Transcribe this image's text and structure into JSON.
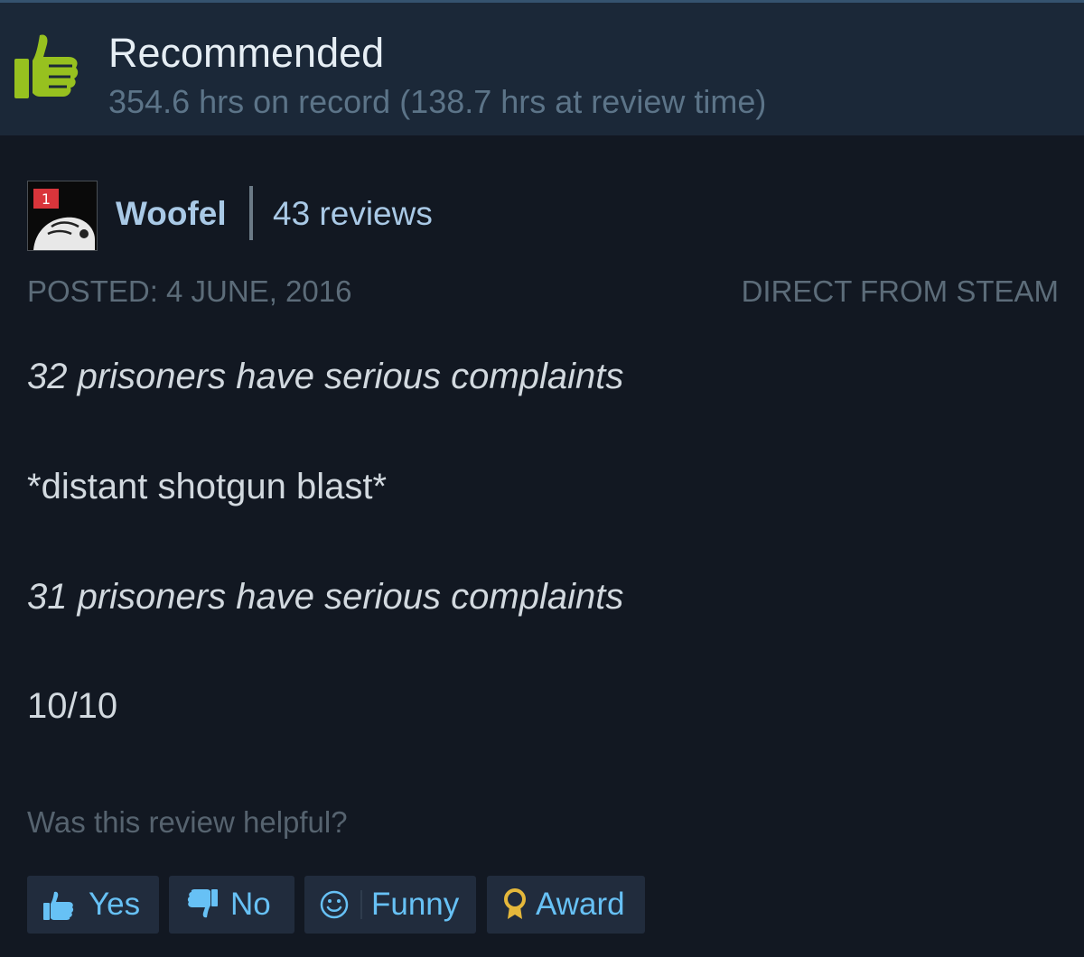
{
  "header": {
    "verdict": "Recommended",
    "hours": "354.6 hrs on record (138.7 hrs at review time)",
    "verdict_icon": "thumbs-up-icon",
    "accent": "#97c11f"
  },
  "author": {
    "badge": "1",
    "name": "Woofel",
    "reviews": "43 reviews"
  },
  "meta": {
    "posted": "POSTED: 4 JUNE, 2016",
    "source": "DIRECT FROM STEAM"
  },
  "review": {
    "lines": [
      "32 prisoners have serious complaints",
      "*distant shotgun blast*",
      "31 prisoners have serious complaints",
      "10/10"
    ]
  },
  "helpful": {
    "question": "Was this review helpful?",
    "buttons": [
      {
        "label": "Yes",
        "icon": "thumbs-up-icon"
      },
      {
        "label": "No",
        "icon": "thumbs-down-icon"
      },
      {
        "label": "Funny",
        "icon": "smiley-icon"
      },
      {
        "label": "Award",
        "icon": "award-icon"
      }
    ]
  },
  "colors": {
    "background": "#121822",
    "header_bg": "#1b2838",
    "link_blue": "#67c1f5",
    "award_gold": "#e5b83b"
  }
}
